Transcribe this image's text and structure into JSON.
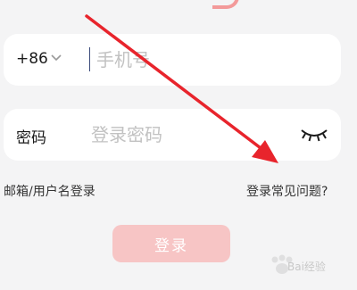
{
  "phone": {
    "country_code": "+86",
    "placeholder": "手机号",
    "value": ""
  },
  "password": {
    "label": "密码",
    "placeholder": "登录密码",
    "value": ""
  },
  "links": {
    "email_login": "邮箱/用户名登录",
    "help": "登录常见问题?"
  },
  "login_button": "登录",
  "colors": {
    "background": "#f4f4f5",
    "login_button": "#f7c5c5",
    "annotation_arrow": "#e8242c"
  },
  "icons": {
    "country_dropdown": "chevron-down-icon",
    "password_visibility": "eye-closed-icon"
  },
  "watermark": "Bai经验"
}
